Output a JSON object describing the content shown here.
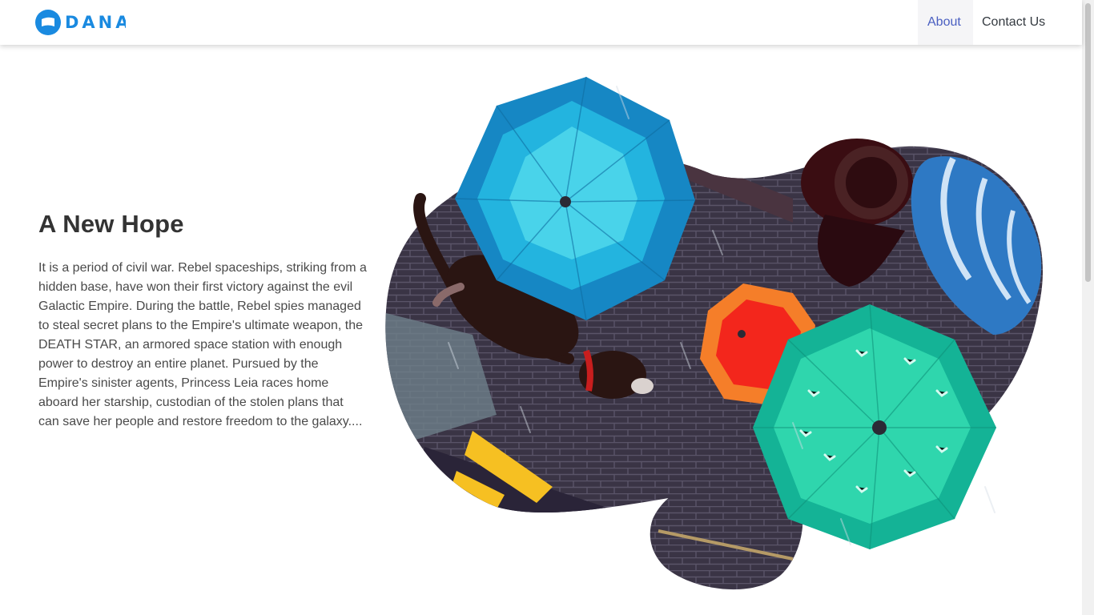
{
  "nav": {
    "brand": {
      "name": "DANA",
      "icon": "dana-logo-icon",
      "color": "#1a8ae0"
    },
    "links": [
      {
        "label": "About",
        "active": true
      },
      {
        "label": "Contact Us",
        "active": false
      }
    ]
  },
  "hero": {
    "title": "A New Hope",
    "text": "It is a period of civil war. Rebel spaceships, striking from a hidden base, have won their first victory against the evil Galactic Empire. During the battle, Rebel spies managed to steal secret plans to the Empire's ultimate weapon, the DEATH STAR, an armored space station with enough power to destroy an entire planet. Pursued by the Empire's sinister agents, Princess Leia races home aboard her starship, custodian of the stolen plans that can save her people and restore freedom to the galaxy....",
    "illustration": {
      "name": "umbrellas-in-rain-illustration",
      "colors": {
        "blue_umbrella": "#1b9bd6",
        "orange_umbrella": "#f4551e",
        "green_umbrella": "#1ec3a3",
        "striped_umbrella": "#2e79c4",
        "brick_wall": "#3b3445",
        "dog": "#2a1512",
        "collar": "#c81e1e"
      }
    }
  },
  "theme": {
    "accent": "#4a5fc1",
    "text": "#343a40"
  }
}
